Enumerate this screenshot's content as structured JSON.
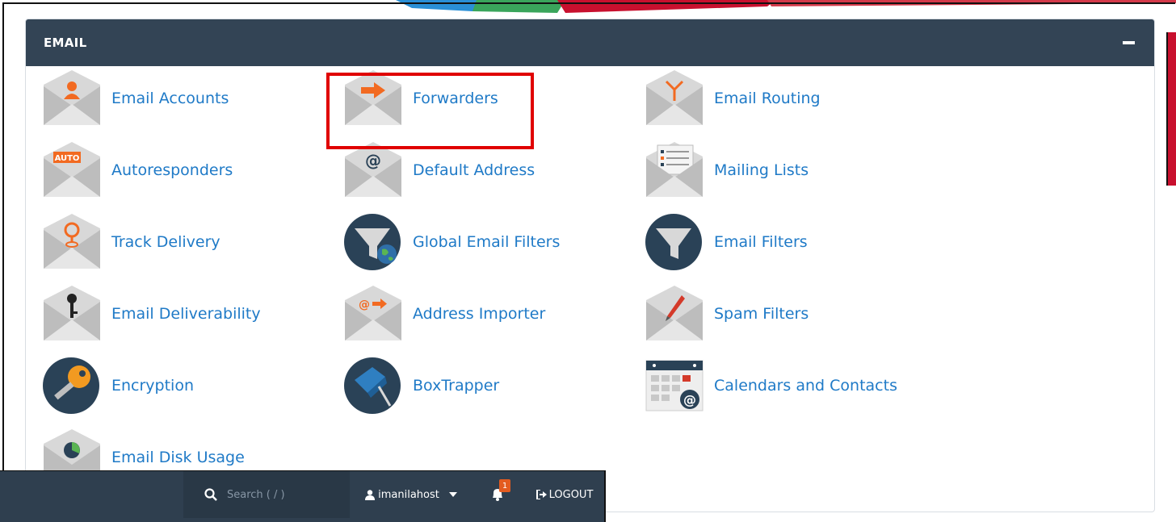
{
  "panel": {
    "title": "EMAIL"
  },
  "items": [
    {
      "label": "Email Accounts",
      "icon": "email-accounts-icon"
    },
    {
      "label": "Forwarders",
      "icon": "forwarders-icon"
    },
    {
      "label": "Email Routing",
      "icon": "email-routing-icon"
    },
    {
      "label": "Autoresponders",
      "icon": "autoresponders-icon",
      "icon_text": "AUTO"
    },
    {
      "label": "Default Address",
      "icon": "default-address-icon",
      "icon_text": "@"
    },
    {
      "label": "Mailing Lists",
      "icon": "mailing-lists-icon"
    },
    {
      "label": "Track Delivery",
      "icon": "track-delivery-icon"
    },
    {
      "label": "Global Email Filters",
      "icon": "global-email-filters-icon"
    },
    {
      "label": "Email Filters",
      "icon": "email-filters-icon"
    },
    {
      "label": "Email Deliverability",
      "icon": "email-deliverability-icon"
    },
    {
      "label": "Address Importer",
      "icon": "address-importer-icon",
      "icon_text": "@"
    },
    {
      "label": "Spam Filters",
      "icon": "spam-filters-icon"
    },
    {
      "label": "Encryption",
      "icon": "encryption-icon"
    },
    {
      "label": "BoxTrapper",
      "icon": "boxtrapper-icon"
    },
    {
      "label": "Calendars and Contacts",
      "icon": "calendars-contacts-icon",
      "icon_text": "@"
    },
    {
      "label": "Email Disk Usage",
      "icon": "email-disk-usage-icon"
    }
  ],
  "navbar": {
    "search_placeholder": "Search ( / )",
    "username": "imanilahost",
    "notification_count": "1",
    "logout_label": "LOGOUT"
  },
  "colors": {
    "header_bg": "#334455",
    "link": "#1f7ac7",
    "accent_orange": "#f26a21",
    "highlight": "#e00000",
    "navbar_bg": "#2f3f4f"
  }
}
